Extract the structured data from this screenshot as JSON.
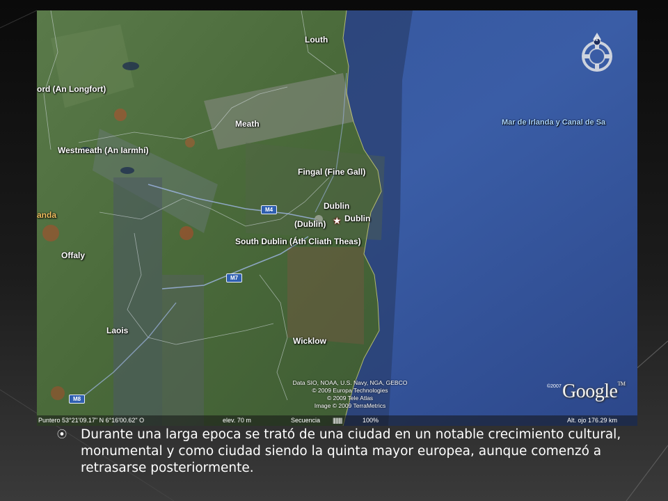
{
  "map": {
    "places": [
      {
        "id": "louth",
        "label": "Louth"
      },
      {
        "id": "longford",
        "label": "ord (An Longfort)"
      },
      {
        "id": "meath",
        "label": "Meath"
      },
      {
        "id": "westmeath",
        "label": "Westmeath (An Iarmhí)"
      },
      {
        "id": "fingal",
        "label": "Fingal (Fine Gall)"
      },
      {
        "id": "dublin",
        "label": "Dublin"
      },
      {
        "id": "dublin-paren",
        "label": "(Dublin)"
      },
      {
        "id": "dublin-city",
        "label": "Dublin"
      },
      {
        "id": "south-dublin",
        "label": "South Dublin (Áth Cliath Theas)"
      },
      {
        "id": "offaly",
        "label": "Offaly"
      },
      {
        "id": "laois",
        "label": "Laois"
      },
      {
        "id": "wicklow",
        "label": "Wicklow"
      },
      {
        "id": "anda",
        "label": "anda"
      }
    ],
    "sea_label": "Mar de Irlanda y Canal de Sa",
    "roads": [
      "M4",
      "M7",
      "M8"
    ],
    "credits": [
      "Data SIO, NOAA, U.S. Navy, NGA, GEBCO",
      "© 2009 Europa Technologies",
      "© 2009 Tele Atlas",
      "Image © 2009 TerraMetrics"
    ],
    "logo_text": "Google",
    "logo_tm": "TM",
    "copyright_year": "©2007",
    "compass_letter": "N",
    "status": {
      "pointer": "Puntero  53°21'09.17\" N    6°16'00.62\" O",
      "elevation": "elev.  70 m",
      "streaming": "Secuencia",
      "stream_bars": "||||||||||",
      "stream_percent": "100%",
      "eye_alt": "Alt. ojo  176.29 km"
    }
  },
  "caption": {
    "text": "Durante una larga epoca se trató de una ciudad en un notable crecimiento cultural, monumental y como ciudad siendo la quinta mayor europea, aunque comenzó a retrasarse posteriormente."
  },
  "colors": {
    "sea": "#2f4a8a",
    "land": "#4a6a3a",
    "road_badge": "#2f5fb0",
    "sea_label": "#a9d4ff"
  }
}
